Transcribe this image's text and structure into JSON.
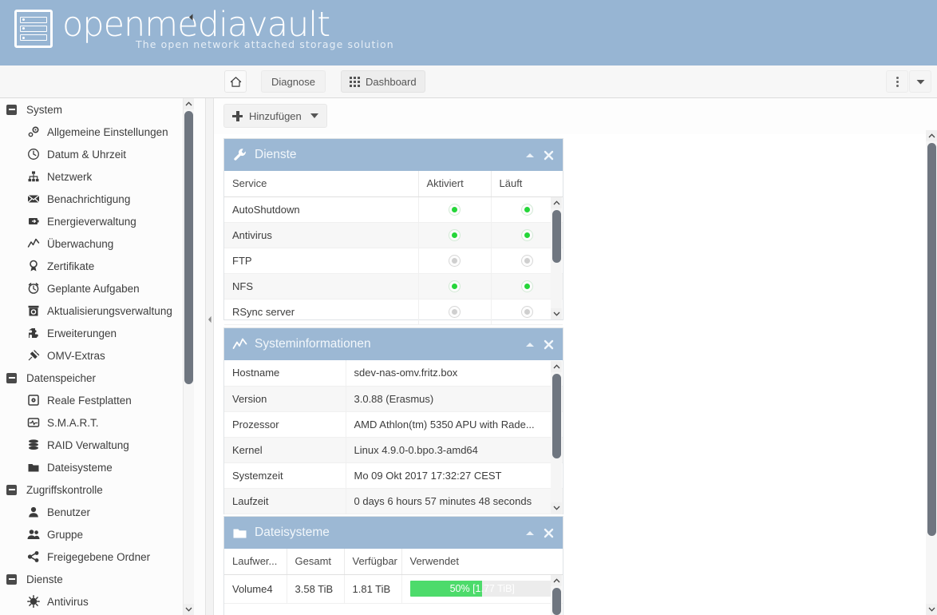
{
  "brand": {
    "name": "openmediavault",
    "tagline": "The open network attached storage solution",
    "banner_color": "#97b5d3",
    "panel_header_color": "#9cb8d4"
  },
  "topbar": {
    "collapse_icon": "chevron-left-icon",
    "home_icon": "home-icon",
    "diagnose_label": "Diagnose",
    "dashboard_label": "Dashboard",
    "dashboard_icon": "grid-icon",
    "overflow_icon": "vertical-dots-icon",
    "caret_icon": "chevron-down-icon"
  },
  "sidebar": {
    "groups": [
      {
        "label": "System",
        "items": [
          {
            "label": "Allgemeine Einstellungen",
            "icon": "gear-cog-icon"
          },
          {
            "label": "Datum & Uhrzeit",
            "icon": "clock-icon"
          },
          {
            "label": "Netzwerk",
            "icon": "network-icon"
          },
          {
            "label": "Benachrichtigung",
            "icon": "envelope-icon"
          },
          {
            "label": "Energieverwaltung",
            "icon": "power-plug-icon"
          },
          {
            "label": "Überwachung",
            "icon": "chart-line-icon"
          },
          {
            "label": "Zertifikate",
            "icon": "award-icon"
          },
          {
            "label": "Geplante Aufgaben",
            "icon": "alarm-clock-icon"
          },
          {
            "label": "Aktualisierungsverwaltung",
            "icon": "update-box-icon"
          },
          {
            "label": "Erweiterungen",
            "icon": "puzzle-icon"
          },
          {
            "label": "OMV-Extras",
            "icon": "plug-icon"
          }
        ]
      },
      {
        "label": "Datenspeicher",
        "items": [
          {
            "label": "Reale Festplatten",
            "icon": "hard-disk-icon"
          },
          {
            "label": "S.M.A.R.T.",
            "icon": "monitor-pulse-icon"
          },
          {
            "label": "RAID Verwaltung",
            "icon": "database-stack-icon"
          },
          {
            "label": "Dateisysteme",
            "icon": "folder-icon"
          }
        ]
      },
      {
        "label": "Zugriffskontrolle",
        "items": [
          {
            "label": "Benutzer",
            "icon": "user-icon"
          },
          {
            "label": "Gruppe",
            "icon": "users-icon"
          },
          {
            "label": "Freigegebene Ordner",
            "icon": "share-icon"
          }
        ]
      },
      {
        "label": "Dienste",
        "items": [
          {
            "label": "Antivirus",
            "icon": "virus-icon"
          }
        ]
      }
    ]
  },
  "content": {
    "add_button_label": "Hinzufügen",
    "add_button_icon": "plus-icon",
    "add_button_caret": "chevron-down-icon"
  },
  "panels": [
    {
      "id": "services",
      "title": "Dienste",
      "icon": "wrench-icon",
      "collapse_icon": "chevron-up-icon",
      "close_icon": "close-icon",
      "columns": [
        "Service",
        "Aktiviert",
        "Läuft"
      ],
      "rows": [
        {
          "service": "AutoShutdown",
          "enabled": true,
          "running": true
        },
        {
          "service": "Antivirus",
          "enabled": true,
          "running": true
        },
        {
          "service": "FTP",
          "enabled": false,
          "running": false
        },
        {
          "service": "NFS",
          "enabled": true,
          "running": true
        },
        {
          "service": "RSync server",
          "enabled": false,
          "running": false
        }
      ]
    },
    {
      "id": "sysinfo",
      "title": "Systeminformationen",
      "icon": "chart-line-icon",
      "collapse_icon": "chevron-up-icon",
      "close_icon": "close-icon",
      "rows": [
        {
          "key": "Hostname",
          "value": "sdev-nas-omv.fritz.box"
        },
        {
          "key": "Version",
          "value": "3.0.88 (Erasmus)"
        },
        {
          "key": "Prozessor",
          "value": "AMD Athlon(tm) 5350 APU with Rade..."
        },
        {
          "key": "Kernel",
          "value": "Linux 4.9.0-0.bpo.3-amd64"
        },
        {
          "key": "Systemzeit",
          "value": "Mo 09 Okt 2017 17:32:27 CEST"
        },
        {
          "key": "Laufzeit",
          "value": "0 days 6 hours 57 minutes 48 seconds"
        }
      ]
    },
    {
      "id": "filesystems",
      "title": "Dateisysteme",
      "icon": "folder-icon",
      "collapse_icon": "chevron-up-icon",
      "close_icon": "close-icon",
      "columns": [
        "Laufwer...",
        "Gesamt",
        "Verfügbar",
        "Verwendet"
      ],
      "rows": [
        {
          "device": "Volume4",
          "total": "3.58 TiB",
          "available": "1.81 TiB",
          "used_percent": 50,
          "used_text": "50% [1.77 TiB]",
          "bar_color": "#4ddb6b"
        }
      ]
    }
  ]
}
